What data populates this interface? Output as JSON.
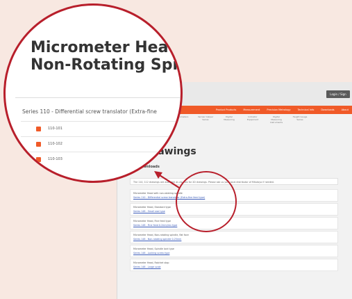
{
  "page": {
    "login_label": "Login / Sign",
    "nav_items": [
      "Product Products",
      "Measurement",
      "Precision Metrology",
      "Technical Info",
      "Downloads",
      "About"
    ],
    "subnav_items": [
      "Micrometers",
      "Vernier Caliper Series",
      "Digital Measuring",
      "Indicator Equipment",
      "Digital Measuring Instruments",
      "Height Gauge Series"
    ],
    "heading": "D-Drawings",
    "section_label": "Downloads",
    "intro_text": "The 110, 112 drawings are available as zip files for 2D drawings. Please ask us your local distributor of Mitutoyo if needed.",
    "downloads": [
      {
        "desc": "Micrometer Head with non-rotating spindle",
        "link": "Series 110 - Differential screw translator (Extra-fine feed type)"
      },
      {
        "desc": "Micrometer Head, Standard type",
        "link": "Series 148 - Small size type"
      },
      {
        "desc": "Micrometer Head, Fine feed type",
        "link": "Series 148 - Fine feed 0.2mm/rev type"
      },
      {
        "desc": "Micrometer Head, Non-rotating spindle, flat face",
        "link": "Series 148 - Non-rotating spindle 0-25mm"
      },
      {
        "desc": "Micrometer Head, Spindle lock type",
        "link": "Series 148 - Locking screw type"
      },
      {
        "desc": "Micrometer Head, Ratchet stop",
        "link": "Series 148 - Large scale"
      }
    ]
  },
  "magnifier": {
    "title_line1": "Micrometer Head wi",
    "title_line2": "Non-Rotating Spindle",
    "series_text": "Series 110 - Differential screw translator (Extra-fine",
    "items": [
      "110-101",
      "110-102",
      "110-103"
    ]
  },
  "colors": {
    "accent": "#f05a28",
    "highlight": "#b81f2b",
    "background": "#f8e8e1"
  }
}
